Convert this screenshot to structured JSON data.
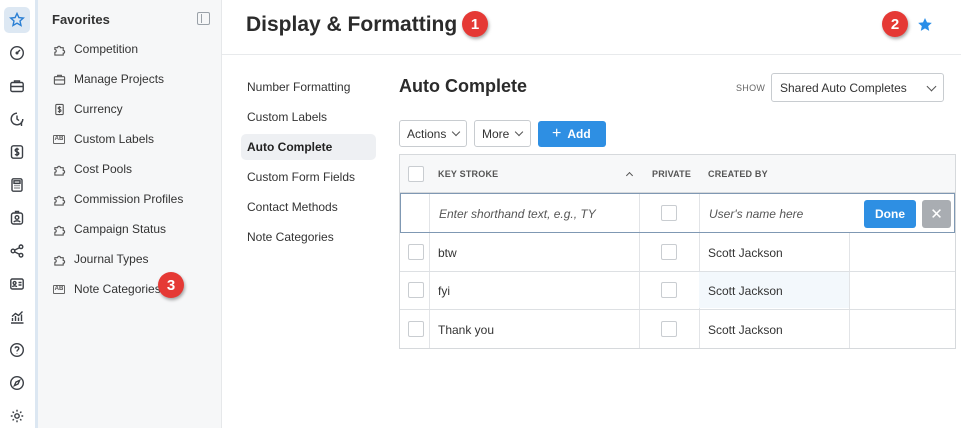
{
  "page": {
    "title": "Display & Formatting"
  },
  "callouts": [
    "1",
    "2",
    "3"
  ],
  "rail": {
    "icons": [
      "star-icon",
      "speedometer-icon",
      "briefcase-icon",
      "clock-dollar-icon",
      "dollar-icon",
      "calculator-icon",
      "id-badge-icon",
      "share-icon",
      "contact-card-icon",
      "analytics-icon",
      "help-icon",
      "compass-icon",
      "settings-icon"
    ]
  },
  "favorites": {
    "title": "Favorites",
    "items": [
      {
        "label": "Competition",
        "icon": "puzzle-icon"
      },
      {
        "label": "Manage Projects",
        "icon": "briefcase-icon"
      },
      {
        "label": "Currency",
        "icon": "currency-doc-icon"
      },
      {
        "label": "Custom Labels",
        "icon": "ab-label-icon",
        "badge": "AB"
      },
      {
        "label": "Cost Pools",
        "icon": "puzzle-icon"
      },
      {
        "label": "Commission Profiles",
        "icon": "puzzle-icon"
      },
      {
        "label": "Campaign Status",
        "icon": "puzzle-icon"
      },
      {
        "label": "Journal Types",
        "icon": "puzzle-icon"
      },
      {
        "label": "Note Categories",
        "icon": "ab-label-icon",
        "badge": "AB"
      }
    ]
  },
  "subnav": {
    "items": [
      "Number Formatting",
      "Custom Labels",
      "Auto Complete",
      "Custom Form Fields",
      "Contact Methods",
      "Note Categories"
    ],
    "active": "Auto Complete"
  },
  "section": {
    "title": "Auto Complete",
    "show_label": "SHOW",
    "show_value": "Shared Auto Completes"
  },
  "toolbar": {
    "actions": "Actions",
    "more": "More",
    "add": "Add"
  },
  "grid": {
    "headers": {
      "keystroke": "KEY STROKE",
      "private": "PRIVATE",
      "created_by": "CREATED BY"
    },
    "edit_row": {
      "keystroke_placeholder": "Enter shorthand text, e.g., TY",
      "user_placeholder": "User's name here",
      "done": "Done",
      "cancel": "✕"
    },
    "rows": [
      {
        "keystroke": "btw",
        "created_by": "Scott Jackson"
      },
      {
        "keystroke": "fyi",
        "created_by": "Scott Jackson"
      },
      {
        "keystroke": "Thank you",
        "created_by": "Scott Jackson"
      }
    ]
  },
  "colors": {
    "accent": "#2e8fe3",
    "callout": "#e53935"
  }
}
